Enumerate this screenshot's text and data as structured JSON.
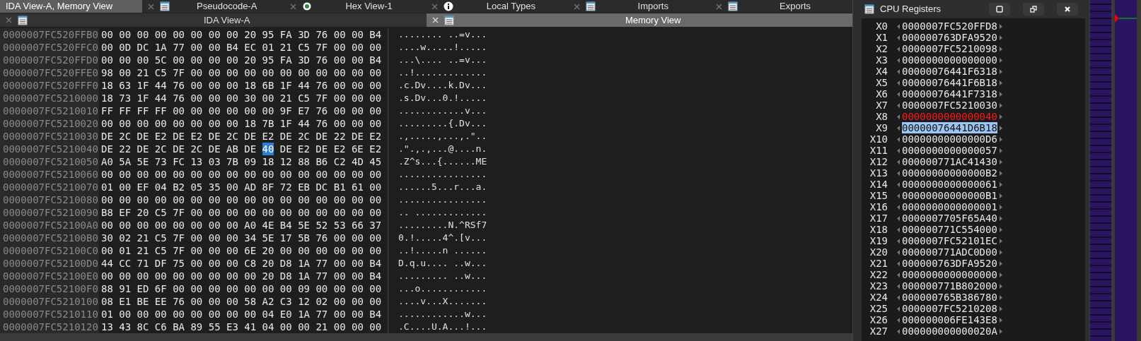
{
  "tabs": [
    {
      "label": "IDA View-A, Memory View",
      "kind": "disasm",
      "selected": true
    },
    {
      "label": "Pseudocode-A",
      "kind": "pseudocode",
      "selected": false
    },
    {
      "label": "Hex View-1",
      "kind": "hex",
      "selected": false
    },
    {
      "label": "Local Types",
      "kind": "types",
      "selected": false
    },
    {
      "label": "Imports",
      "kind": "imports",
      "selected": false
    },
    {
      "label": "Exports",
      "kind": "exports",
      "selected": false
    }
  ],
  "subtabs": [
    {
      "label": "IDA View-A",
      "selected": false
    },
    {
      "label": "Memory View",
      "selected": true
    }
  ],
  "memory_view": {
    "rows": [
      {
        "address": "0000007FC520FFB0",
        "segments": [
          {
            "text": "00 00 00 00 00 00 00 00 20 95 FA 3D 76 00 00 B4",
            "selected": false
          }
        ],
        "ascii": "........ ..=v..."
      },
      {
        "address": "0000007FC520FFC0",
        "segments": [
          {
            "text": "00 0D DC 1A 77 00 00 B4 EC 01 21 C5 7F 00 00 00",
            "selected": false
          }
        ],
        "ascii": "....w.....!....."
      },
      {
        "address": "0000007FC520FFD0",
        "segments": [
          {
            "text": "00 00 00 5C 00 00 00 00 20 95 FA 3D 76 00 00 B4",
            "selected": false
          }
        ],
        "ascii": "...\\.... ..=v..."
      },
      {
        "address": "0000007FC520FFE0",
        "segments": [
          {
            "text": "98 00 21 C5 7F 00 00 00 00 00 00 00 00 00 00 00",
            "selected": false
          }
        ],
        "ascii": "..!............."
      },
      {
        "address": "0000007FC520FFF0",
        "segments": [
          {
            "text": "18 63 1F 44 76 00 00 00 18 6B 1F 44 76 00 00 00",
            "selected": false
          }
        ],
        "ascii": ".c.Dv....k.Dv..."
      },
      {
        "address": "0000007FC5210000",
        "segments": [
          {
            "text": "18 73 1F 44 76 00 00 00 30 00 21 C5 7F 00 00 00",
            "selected": false
          }
        ],
        "ascii": ".s.Dv...0.!....."
      },
      {
        "address": "0000007FC5210010",
        "segments": [
          {
            "text": "FF FF FF FF 00 00 00 00 00 00 9F E7 76 00 00 00",
            "selected": false
          }
        ],
        "ascii": "............v..."
      },
      {
        "address": "0000007FC5210020",
        "segments": [
          {
            "text": "00 00 00 00 00 00 00 00 18 7B 1F 44 76 00 00 00",
            "selected": false
          }
        ],
        "ascii": ".........{.Dv..."
      },
      {
        "address": "0000007FC5210030",
        "segments": [
          {
            "text": "DE 2C DE E2 DE E2 DE 2C DE E2 DE 2C DE 22 DE E2",
            "selected": false
          }
        ],
        "ascii": ".,.....,...,.\".."
      },
      {
        "address": "0000007FC5210040",
        "segments": [
          {
            "text": "DE 22 DE 2C DE 2C DE AB DE",
            "selected": false
          },
          {
            "text": "40",
            "selected": true
          },
          {
            "text": "DE E2 DE E2 6E E2",
            "selected": false
          }
        ],
        "ascii": ".\".,.,...@....n."
      },
      {
        "address": "0000007FC5210050",
        "segments": [
          {
            "text": "A0 5A 5E 73 FC 13 03 7B 09 18 12 88 B6 C2 4D 45",
            "selected": false
          }
        ],
        "ascii": ".Z^s...{......ME"
      },
      {
        "address": "0000007FC5210060",
        "segments": [
          {
            "text": "00 00 00 00 00 00 00 00 00 00 00 00 00 00 00 00",
            "selected": false
          }
        ],
        "ascii": "................"
      },
      {
        "address": "0000007FC5210070",
        "segments": [
          {
            "text": "01 00 EF 04 B2 05 35 00 AD 8F 72 EB DC B1 61 00",
            "selected": false
          }
        ],
        "ascii": "......5...r...a."
      },
      {
        "address": "0000007FC5210080",
        "segments": [
          {
            "text": "00 00 00 00 00 00 00 00 00 00 00 00 00 00 00 00",
            "selected": false
          }
        ],
        "ascii": "................"
      },
      {
        "address": "0000007FC5210090",
        "segments": [
          {
            "text": "B8 EF 20 C5 7F 00 00 00 00 00 00 00 00 00 00 00",
            "selected": false
          }
        ],
        "ascii": ".. ............."
      },
      {
        "address": "0000007FC52100A0",
        "segments": [
          {
            "text": "00 00 00 00 00 00 00 00 A0 4E B4 5E 52 53 66 37",
            "selected": false
          }
        ],
        "ascii": ".........N.^RSf7"
      },
      {
        "address": "0000007FC52100B0",
        "segments": [
          {
            "text": "30 02 21 C5 7F 00 00 00 34 5E 17 5B 76 00 00 00",
            "selected": false
          }
        ],
        "ascii": "0.!.....4^.[v..."
      },
      {
        "address": "0000007FC52100C0",
        "segments": [
          {
            "text": "00 01 21 C5 7F 00 00 00 6E 20 00 00 00 00 00 00",
            "selected": false
          }
        ],
        "ascii": "..!.....n ......"
      },
      {
        "address": "0000007FC52100D0",
        "segments": [
          {
            "text": "44 CC 71 DF 75 00 00 00 C8 20 D8 1A 77 00 00 B4",
            "selected": false
          }
        ],
        "ascii": "D.q.u.... ..w..."
      },
      {
        "address": "0000007FC52100E0",
        "segments": [
          {
            "text": "00 00 00 00 00 00 00 00 00 20 D8 1A 77 00 00 B4",
            "selected": false
          }
        ],
        "ascii": "......... ..w..."
      },
      {
        "address": "0000007FC52100F0",
        "segments": [
          {
            "text": "88 91 ED 6F 00 00 00 00 00 00 00 09 00 00 00 00",
            "selected": false
          }
        ],
        "ascii": "...o............"
      },
      {
        "address": "0000007FC5210100",
        "segments": [
          {
            "text": "08 E1 BE EE 76 00 00 00 58 A2 C3 12 02 00 00 00",
            "selected": false
          }
        ],
        "ascii": "....v...X......."
      },
      {
        "address": "0000007FC5210110",
        "segments": [
          {
            "text": "01 00 00 00 00 00 00 00 00 04 E0 1A 77 00 00 B4",
            "selected": false
          }
        ],
        "ascii": "............w..."
      },
      {
        "address": "0000007FC5210120",
        "segments": [
          {
            "text": "13 43 8C C6 BA 89 55 E3 41 04 00 00 21 00 00 00",
            "selected": false
          }
        ],
        "ascii": ".C....U.A...!..."
      }
    ]
  },
  "registers": {
    "title": "CPU Registers",
    "rows": [
      {
        "name": "X0",
        "value": "0000007FC520FFD8",
        "changed": false,
        "selected": false
      },
      {
        "name": "X1",
        "value": "000000763DFA9520",
        "changed": false,
        "selected": false
      },
      {
        "name": "X2",
        "value": "0000007FC5210098",
        "changed": false,
        "selected": false
      },
      {
        "name": "X3",
        "value": "0000000000000000",
        "changed": false,
        "selected": false
      },
      {
        "name": "X4",
        "value": "00000076441F6318",
        "changed": false,
        "selected": false
      },
      {
        "name": "X5",
        "value": "00000076441F6B18",
        "changed": false,
        "selected": false
      },
      {
        "name": "X6",
        "value": "00000076441F7318",
        "changed": false,
        "selected": false
      },
      {
        "name": "X7",
        "value": "0000007FC5210030",
        "changed": false,
        "selected": false
      },
      {
        "name": "X8",
        "value": "0000000000000040",
        "changed": true,
        "selected": false
      },
      {
        "name": "X9",
        "value": "00000076441D6B18",
        "changed": false,
        "selected": true
      },
      {
        "name": "X10",
        "value": "00000000000000D6",
        "changed": false,
        "selected": false
      },
      {
        "name": "X11",
        "value": "0000000000000057",
        "changed": false,
        "selected": false
      },
      {
        "name": "X12",
        "value": "000000771AC41430",
        "changed": false,
        "selected": false
      },
      {
        "name": "X13",
        "value": "00000000000000B2",
        "changed": false,
        "selected": false
      },
      {
        "name": "X14",
        "value": "0000000000000061",
        "changed": false,
        "selected": false
      },
      {
        "name": "X15",
        "value": "00000000000000B1",
        "changed": false,
        "selected": false
      },
      {
        "name": "X16",
        "value": "0000000000000001",
        "changed": false,
        "selected": false
      },
      {
        "name": "X17",
        "value": "0000007705F65A40",
        "changed": false,
        "selected": false
      },
      {
        "name": "X18",
        "value": "000000771C554000",
        "changed": false,
        "selected": false
      },
      {
        "name": "X19",
        "value": "0000007FC52101EC",
        "changed": false,
        "selected": false
      },
      {
        "name": "X20",
        "value": "000000771ADC0D00",
        "changed": false,
        "selected": false
      },
      {
        "name": "X21",
        "value": "000000763DFA9520",
        "changed": false,
        "selected": false
      },
      {
        "name": "X22",
        "value": "0000000000000000",
        "changed": false,
        "selected": false
      },
      {
        "name": "X23",
        "value": "000000771B802000",
        "changed": false,
        "selected": false
      },
      {
        "name": "X24",
        "value": "000000765B386780",
        "changed": false,
        "selected": false
      },
      {
        "name": "X25",
        "value": "0000007FC5210208",
        "changed": false,
        "selected": false
      },
      {
        "name": "X26",
        "value": "000000006FE143E8",
        "changed": false,
        "selected": false
      },
      {
        "name": "X27",
        "value": "000000000000020A",
        "changed": false,
        "selected": false
      }
    ]
  }
}
